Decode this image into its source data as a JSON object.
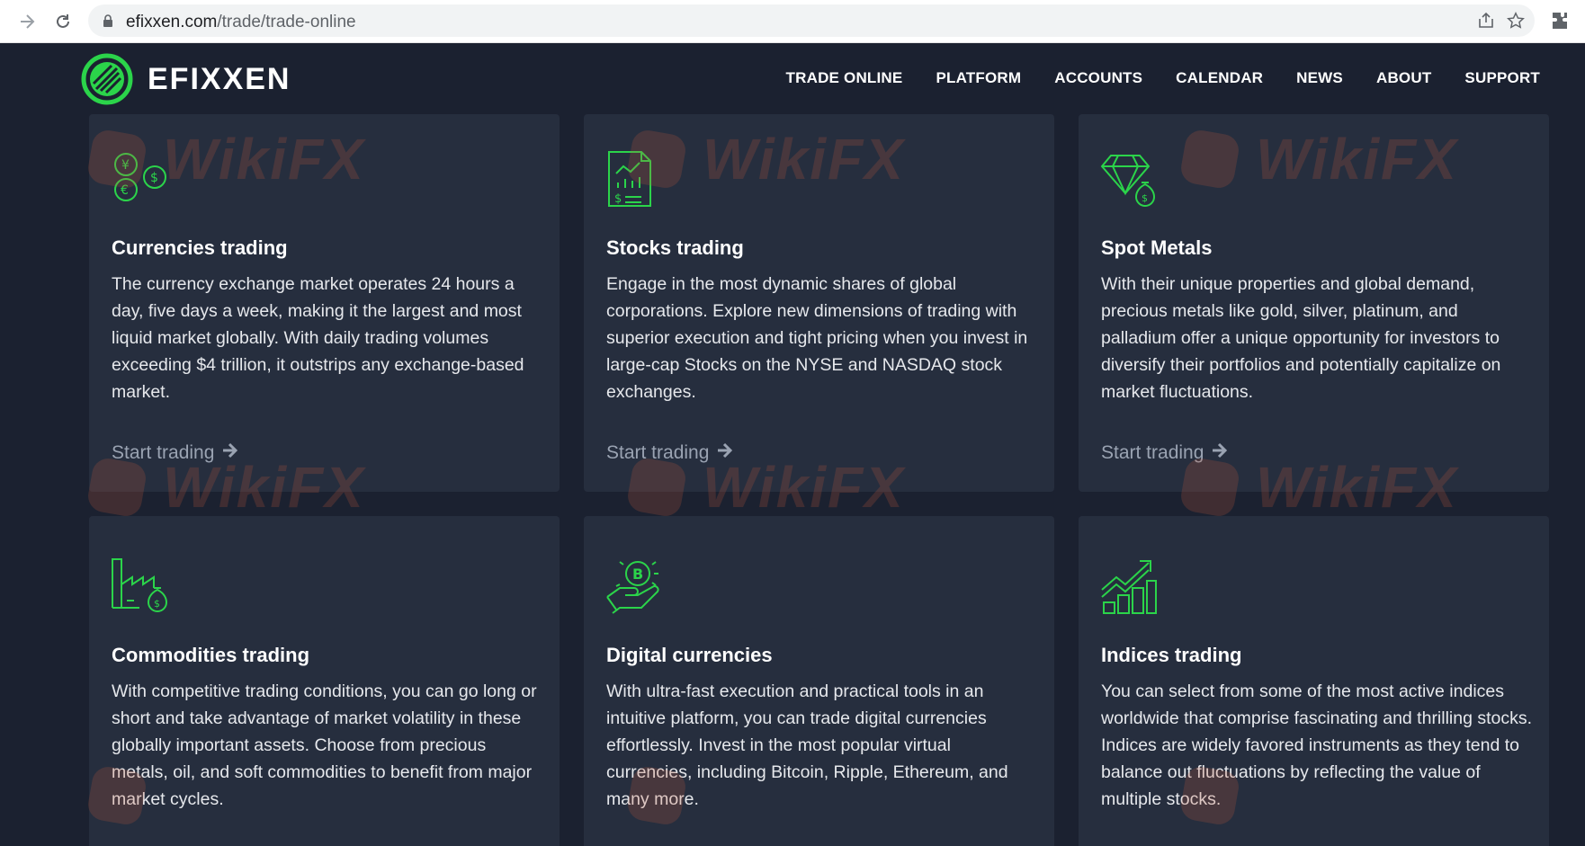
{
  "browser": {
    "url_domain": "efixxen.com",
    "url_path": "/trade/trade-online"
  },
  "header": {
    "logo_text": "EFIXXEN",
    "nav": [
      "TRADE ONLINE",
      "PLATFORM",
      "ACCOUNTS",
      "CALENDAR",
      "NEWS",
      "ABOUT",
      "SUPPORT"
    ]
  },
  "colors": {
    "accent_green": "#2bd44a",
    "background": "#1b2130",
    "card": "#262e3e"
  },
  "cards": [
    {
      "icon": "currency-coins-icon",
      "title": "Currencies trading",
      "text": "The currency exchange market operates 24 hours a day, five days a week, making it the largest and most liquid market globally. With daily trading volumes exceeding $4 trillion, it outstrips any exchange-based market.",
      "cta": "Start trading"
    },
    {
      "icon": "stock-report-icon",
      "title": "Stocks trading",
      "text": "Engage in the most dynamic shares of global corporations. Explore new dimensions of trading with superior execution and tight pricing when you invest in large-cap Stocks on the NYSE and NASDAQ stock exchanges.",
      "cta": "Start trading"
    },
    {
      "icon": "diamond-moneybag-icon",
      "title": "Spot Metals",
      "text": "With their unique properties and global demand, precious metals like gold, silver, platinum, and palladium offer a unique opportunity for investors to diversify their portfolios and potentially capitalize on market fluctuations.",
      "cta": "Start trading"
    },
    {
      "icon": "factory-moneybag-icon",
      "title": "Commodities trading",
      "text": "With competitive trading conditions, you can go long or short and take advantage of market volatility in these globally important assets. Choose from precious metals, oil, and soft commodities to benefit from major market cycles."
    },
    {
      "icon": "bitcoin-hand-icon",
      "title": "Digital currencies",
      "text": "With ultra-fast execution and practical tools in an intuitive platform, you can trade digital currencies effortlessly. Invest in the most popular virtual currencies, including Bitcoin, Ripple, Ethereum, and many more."
    },
    {
      "icon": "growth-chart-icon",
      "title": "Indices trading",
      "text": "You can select from some of the most active indices worldwide that comprise fascinating and thrilling stocks. Indices are widely favored instruments as they tend to balance out fluctuations by reflecting the value of multiple stocks."
    }
  ],
  "watermark": {
    "text": "WikiFX"
  }
}
